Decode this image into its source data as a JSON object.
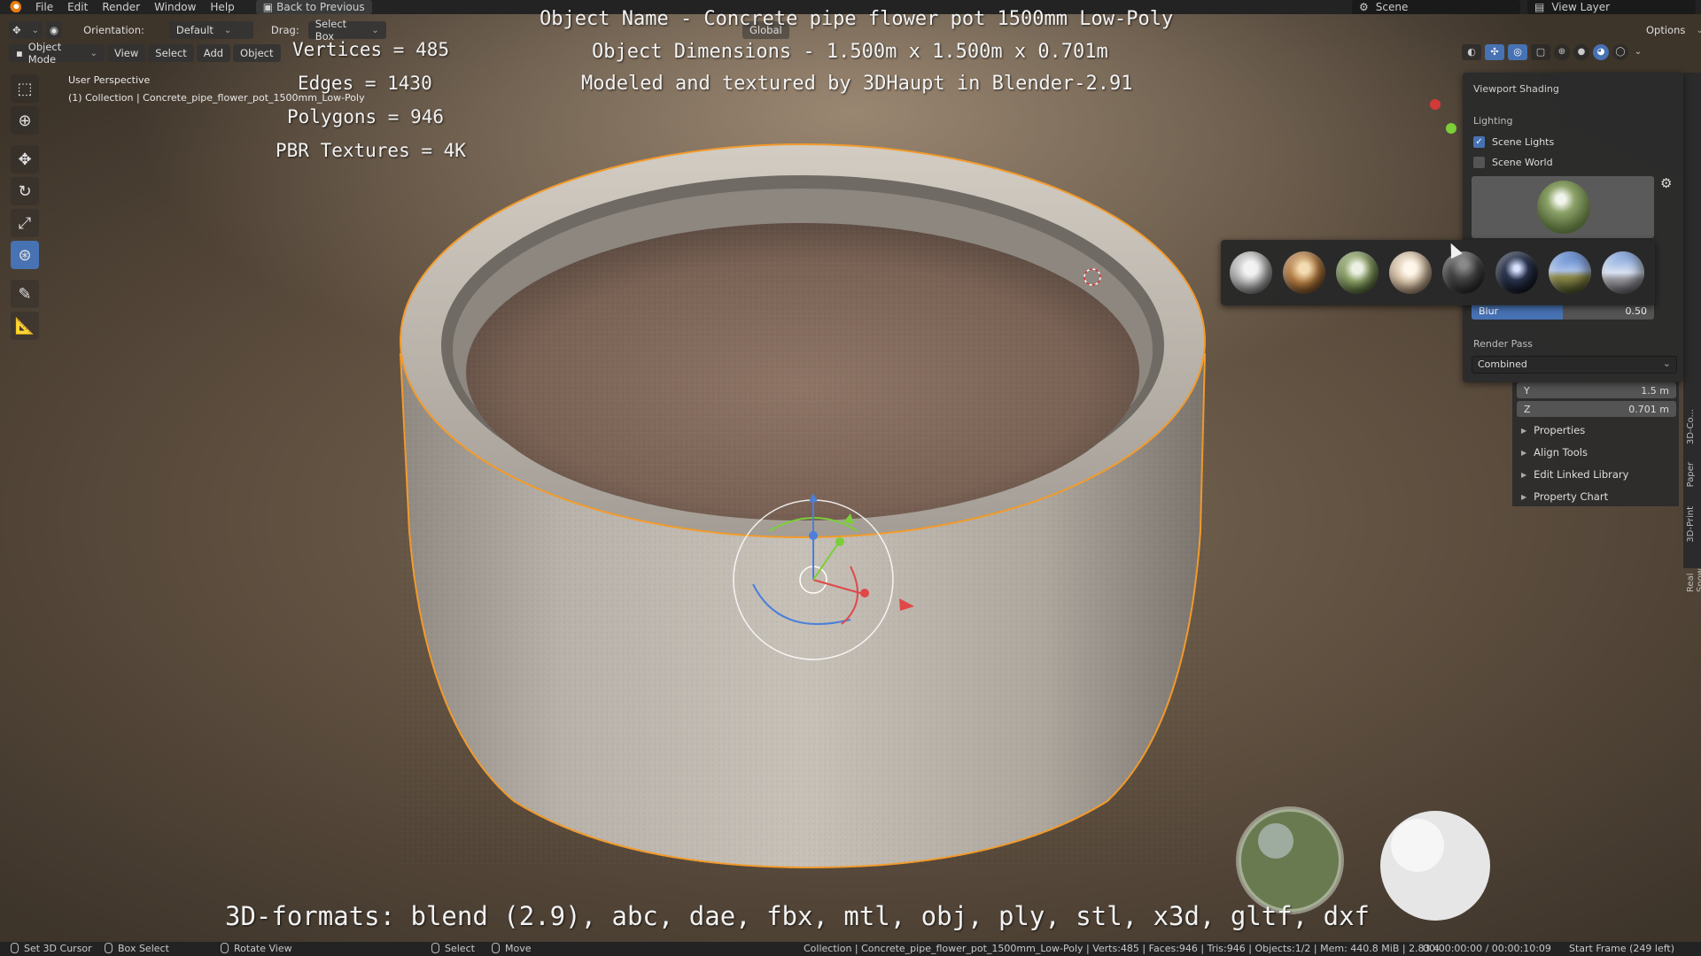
{
  "menubar": {
    "items": [
      "File",
      "Edit",
      "Render",
      "Window",
      "Help"
    ],
    "back_button": "Back to Previous",
    "scene_label": "Scene",
    "view_layer_label": "View Layer"
  },
  "tool_header": {
    "orientation_label": "Orientation:",
    "orientation_value": "Default",
    "drag_label": "Drag:",
    "drag_value": "Select Box",
    "transform_orientation": "Global",
    "options_label": "Options"
  },
  "mode_header": {
    "mode": "Object Mode",
    "menus": [
      "View",
      "Select",
      "Add",
      "Object"
    ]
  },
  "viewport": {
    "perspective": "User Perspective",
    "collection_info": "(1) Collection | Concrete_pipe_flower_pot_1500mm_Low-Poly"
  },
  "overlay": {
    "stats": [
      "Vertices = 485",
      "Edges = 1430",
      "Polygons = 946",
      "PBR Textures = 4K"
    ],
    "object_name": "Object Name - Concrete pipe flower pot 1500mm Low-Poly",
    "dimensions": "Object Dimensions -  1.500m x 1.500m x 0.701m",
    "credit": "Modeled and textured by 3DHaupt in Blender-2.91",
    "formats": "3D-formats: blend (2.9), abc, dae, fbx, mtl, obj, ply, stl, x3d, gltf, dxf"
  },
  "shading_panel": {
    "title": "Viewport Shading",
    "lighting_label": "Lighting",
    "scene_lights": {
      "label": "Scene Lights",
      "checked": true
    },
    "scene_world": {
      "label": "Scene World",
      "checked": false
    },
    "blur": {
      "label": "Blur",
      "value": "0.50",
      "fraction": 0.5
    },
    "render_pass_label": "Render Pass",
    "render_pass_value": "Combined"
  },
  "hdri_options": [
    "city-hdri",
    "interior-hdri",
    "forest-hdri",
    "courtyard-hdri",
    "night-hdri",
    "studio-hdri",
    "sunset-hdri",
    "sky-hdri"
  ],
  "n_panel": {
    "y_label": "Y",
    "y_value": "1.5 m",
    "z_label": "Z",
    "z_value": "0.701 m",
    "sections": [
      "Properties",
      "Align Tools",
      "Edit Linked Library",
      "Property Chart"
    ]
  },
  "side_tabs": [
    "3D-Co...",
    "Paper",
    "3D-Print",
    "Real Snow"
  ],
  "statusbar": {
    "set_cursor": "Set 3D Cursor",
    "box_select": "Box Select",
    "rotate_view": "Rotate View",
    "select": "Select",
    "move": "Move",
    "scene_stats": "Collection | Concrete_pipe_flower_pot_1500mm_Low-Poly | Verts:485 | Faces:946 | Tris:946 | Objects:1/2 | Mem: 440.8 MiB | 2.83.4",
    "timecode": "00:00:00:00 / 00:00:10:09",
    "start_frame": "Start Frame (249 left)"
  },
  "colors": {
    "accent": "#4772b3",
    "selection_outline": "#f39b2b",
    "panel_bg": "#2b2b2b"
  }
}
